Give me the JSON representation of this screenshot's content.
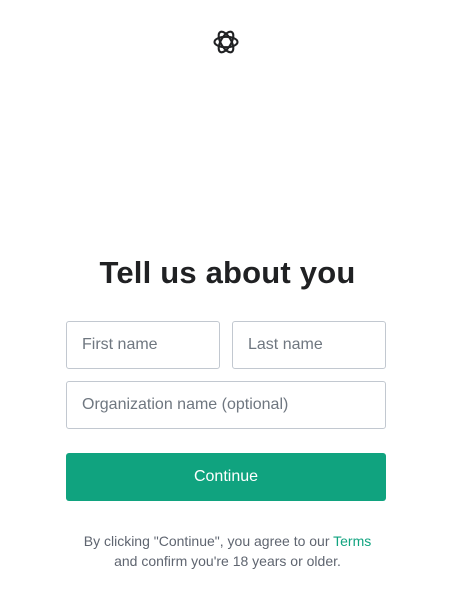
{
  "brand": {
    "logo_icon": "openai-logo-icon"
  },
  "page": {
    "title": "Tell us about you"
  },
  "form": {
    "first_name": {
      "placeholder": "First name",
      "value": ""
    },
    "last_name": {
      "placeholder": "Last name",
      "value": ""
    },
    "organization": {
      "placeholder": "Organization name (optional)",
      "value": ""
    },
    "continue_label": "Continue"
  },
  "legal": {
    "prefix": "By clicking \"Continue\", you agree to our ",
    "terms_link": "Terms",
    "suffix": "and confirm you're 18 years or older."
  },
  "colors": {
    "accent": "#10a37f",
    "text": "#202123",
    "border": "#c2c8d0"
  }
}
